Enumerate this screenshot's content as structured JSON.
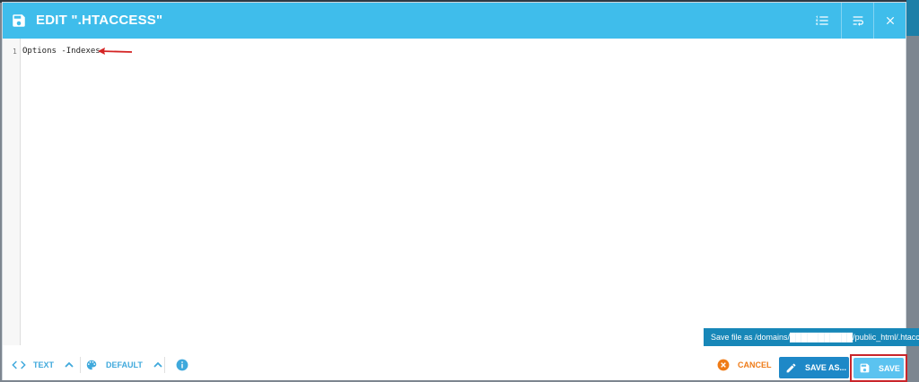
{
  "dialog": {
    "title": "EDIT \".HTACCESS\"",
    "header_icons": [
      "list-numbers-icon",
      "wrap-text-icon",
      "close-icon"
    ]
  },
  "editor": {
    "lines": [
      {
        "number": "1",
        "text": "Options -Indexes"
      }
    ]
  },
  "tooltip": {
    "text": "Save file as /domains/███████████/public_html/.htaccess"
  },
  "footer": {
    "mode_label": "TEXT",
    "theme_label": "DEFAULT",
    "cancel_label": "CANCEL",
    "save_as_label": "SAVE AS...",
    "save_label": "SAVE"
  },
  "colors": {
    "header": "#3fbdeb",
    "accent": "#3fa9dc",
    "cancel": "#ef7b17",
    "save_as": "#1e88c7",
    "save": "#5bc3f0",
    "highlight": "#c9252b"
  }
}
